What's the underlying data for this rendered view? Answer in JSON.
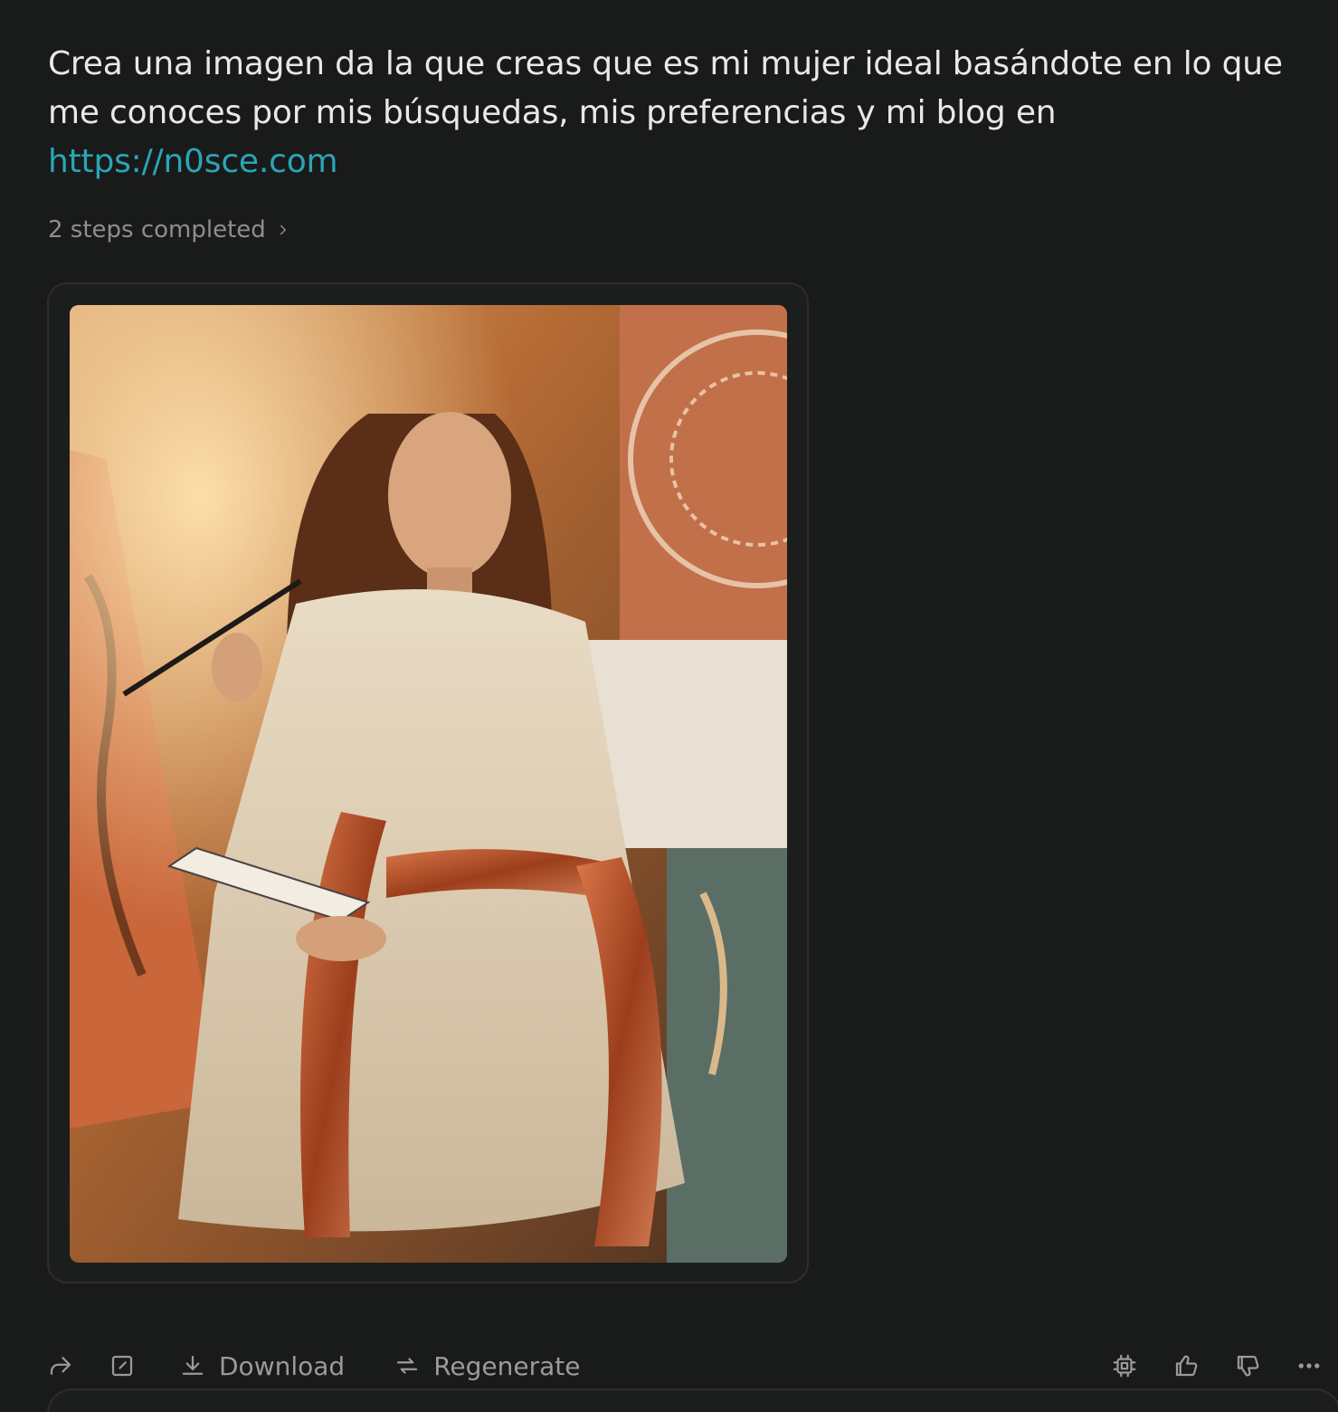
{
  "query": {
    "text": "Crea una imagen da la que creas que es mi mujer ideal basándote en lo que me conoces por mis búsquedas, mis preferencias y mi blog en",
    "link": "https://n0sce.com"
  },
  "steps": {
    "label": "2 steps completed"
  },
  "image": {
    "description_icon": "generated-portrait-image"
  },
  "actions": {
    "download_label": "Download",
    "regenerate_label": "Regenerate"
  },
  "colors": {
    "background": "#191a1a",
    "link": "#2aa5b8",
    "muted": "#9a9b98"
  }
}
